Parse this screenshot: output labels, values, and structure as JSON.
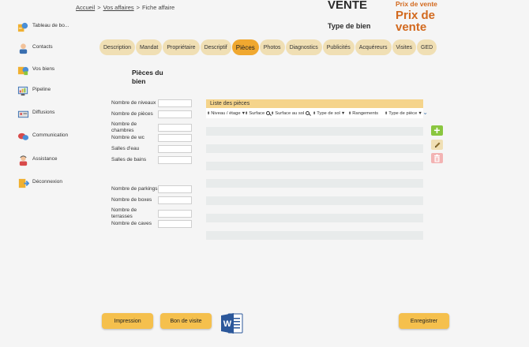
{
  "breadcrumb": {
    "home": "Accueil",
    "sep1": ">",
    "affairs": "Vos affaires",
    "sep2": ">",
    "current": "Fiche affaire"
  },
  "header": {
    "transaction": "VENTE",
    "property_type": "Type de bien",
    "price_label": "Prix de vente",
    "price_value": "Prix de vente"
  },
  "sidebar": {
    "items": [
      {
        "label": "Tableau de bo...",
        "icon": "dashboard-icon"
      },
      {
        "label": "Contacts",
        "icon": "contact-icon"
      },
      {
        "label": "Vos biens",
        "icon": "properties-icon"
      },
      {
        "label": "Pipeline",
        "icon": "pipeline-icon"
      },
      {
        "label": "Diffusions",
        "icon": "diffusion-icon"
      },
      {
        "label": "Communication",
        "icon": "communication-icon"
      },
      {
        "label": "Assistance",
        "icon": "assistance-icon"
      },
      {
        "label": "Déconnexion",
        "icon": "logout-icon"
      }
    ]
  },
  "tabs": [
    "Description",
    "Mandat",
    "Propriétaire",
    "Descriptif",
    "Pièces",
    "Photos",
    "Diagnostics",
    "Publicités",
    "Acquéreurs",
    "Visites",
    "GED"
  ],
  "active_tab": "Pièces",
  "section": {
    "title": "Pièces du bien"
  },
  "form": {
    "group1": [
      {
        "label": "Nombre de niveaux",
        "value": ""
      },
      {
        "label": "Nombre de pièces",
        "value": ""
      },
      {
        "label": "Nombre de chambres",
        "value": ""
      },
      {
        "label": "Nombre de wc",
        "value": ""
      },
      {
        "label": "Salles d'eau",
        "value": ""
      },
      {
        "label": "Salles de bains",
        "value": ""
      }
    ],
    "group2": [
      {
        "label": "Nombre de parkings",
        "value": ""
      },
      {
        "label": "Nombre de boxes",
        "value": ""
      },
      {
        "label": "Nombre de terrasses",
        "value": ""
      },
      {
        "label": "Nombre de caves",
        "value": ""
      }
    ]
  },
  "rooms_table": {
    "title": "Liste des pièces",
    "columns": [
      {
        "label": "Niveau / étage",
        "filter": "dropdown"
      },
      {
        "label": "Surface",
        "filter": "search"
      },
      {
        "label": "Surface au sol",
        "filter": "search"
      },
      {
        "label": "Type de sol",
        "filter": "dropdown"
      },
      {
        "label": "Rangements",
        "filter": "none"
      },
      {
        "label": "Type de pièce",
        "filter": "dropdown"
      }
    ],
    "rows": []
  },
  "actions": {
    "add": "+",
    "edit": "edit-icon",
    "delete": "trash-icon"
  },
  "buttons": {
    "print": "Impression",
    "visit_voucher": "Bon de visite",
    "save": "Enregistrer"
  },
  "colors": {
    "accent": "#f0a830",
    "tab": "#f0dfb4",
    "price": "#d2691e",
    "table_header": "#f5d48b",
    "add": "#8ac63f"
  }
}
